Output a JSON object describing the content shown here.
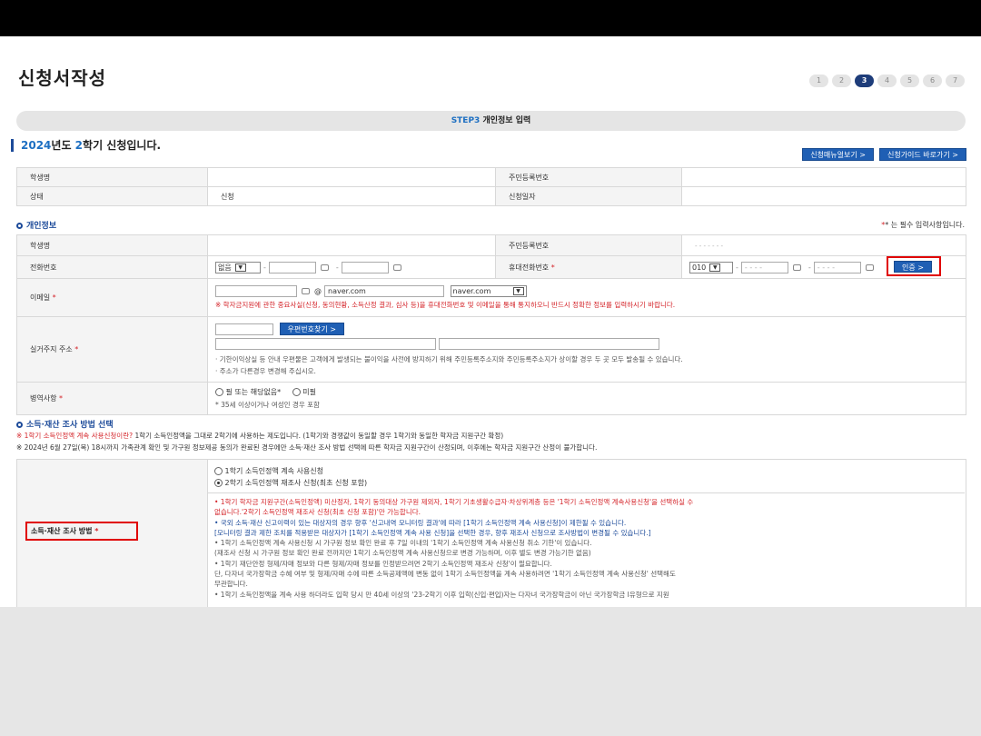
{
  "page": {
    "title": "신청서작성"
  },
  "steps": [
    "1",
    "2",
    "3",
    "4",
    "5",
    "6",
    "7"
  ],
  "active_step": "3",
  "step_banner": {
    "step": "STEP3",
    "label": "개인정보 입력"
  },
  "semester": {
    "year": "2024",
    "year_suffix": "년도 ",
    "term": "2",
    "term_suffix": "학기 신청입니다."
  },
  "buttons": {
    "manual": "신청매뉴얼보기 >",
    "guide": "신청가이드 바로가기 >",
    "verify": "인증 >",
    "zipcode": "우편번호찾기 >"
  },
  "summary": {
    "student_name_label": "학생명",
    "rrn_label": "주민등록번호",
    "status_label": "상태",
    "status_value": "신청",
    "date_label": "신청일자"
  },
  "personal": {
    "section_title": "개인정보",
    "required_note": "* 는 필수 입력사항입니다.",
    "student_name_label": "학생명",
    "rrn_label": "주민등록번호",
    "rrn_value": "- - - - - -    -",
    "phone_label": "전화번호",
    "phone_area": "없음",
    "mobile_label": "휴대전화번호",
    "mobile_prefix": "010",
    "mobile_mid": "- - - -",
    "mobile_last": "- - - -",
    "email_label": "이메일",
    "email_at": "@",
    "email_domain": "naver.com",
    "email_domain_select": "naver.com",
    "email_notice": "※ 학자금지원에 관한 중요사실(신청, 동의현황, 소득산정 결과, 심사 등)을 휴대전화번호 및 이메일을 통해 통지하오니 반드시 정확한 정보를 입력하시기 바랍니다.",
    "address_label": "실거주지 주소",
    "address_note1": "· 기한이익상실 등 안내 우편물은 고객에게 발생되는 불이익을 사전에 방지하기 위해 주민등록주소지와 주민등록주소지가 상이할 경우 두 곳 모두 발송될 수 있습니다.",
    "address_note2": "· 주소가 다른경우 변경해 주십시오.",
    "military_label": "병역사항",
    "military_opt1": "필 또는 해당없음*",
    "military_opt2": "미필",
    "military_note": "* 35세 이상이거나 여성인 경우 포함"
  },
  "income": {
    "section_title": "소득·재산 조사 방법 선택",
    "notice1_red": "※ 1학기 소득인정액 계속 사용신청이란?",
    "notice1_rest": " 1학기 소득인정액을 그대로 2학기에 사용하는 제도입니다. (1학기와 경쟁값이 동일할 경우 1학기와 동일한 학자금 지원구간 확정)",
    "notice2": "※ 2024년 6월 27일(목) 18시까지 가족관계 확인 및 가구원 정보제공 동의가 완료된 경우에만 소득·재산 조사 방법 선택에 따른 학자금 지원구간이 산정되며, 이후에는 학자금 지원구간 산정이 불가합니다.",
    "method_label": "소득·재산 조사 방법",
    "option1": "1학기 소득인정액 계속 사용신청",
    "option2": "2학기 소득인정액 재조사 신청(최초 신청 포함)",
    "bullets": [
      "• 1학기 학자금 지원구간(소득인정액) 미산정자, 1학기 동의대상 가구원 제외자, 1학기 기초생활수급자·차상위계층 등은 '1학기 소득인정액 계속사용신청'을 선택하실 수",
      "  없습니다.'2학기 소득인정액 재조사 신청(최초 신청 포함)'만 가능합니다.",
      "• 국외 소득·재산 신고이력이 있는 대상자의 경우 향후 '신고내역 모니터링 결과'에 따라 [1학기 소득인정액 계속 사용신청]이 제한될 수 있습니다.",
      "  [모니터링 결과 제한 조치를 적용받은 대상자가 [1학기 소득인정액 계속 사용 신청]을 선택한 경우, 향후 재조사 신청으로 조사방법이 변경될 수 있습니다.]",
      "• 1학기 소득인정액 계속 사용신청 시 가구원 정보 확인 완료 후 7일 이내의 '1학기 소득인정액 계속 사용신청 취소 기한'이 있습니다.",
      "  (재조사 신청 시 가구원 정보 확인 완료 전까지만 1학기 소득인정액 계속 사용신청으로 변경 가능하며, 이후 별도 변경 가능기한 없음)",
      "• 1학기 재단안정 형제/자매 정보와 다른 형제/자매 정보를 인정받으려면 2학기 소득인정액 재조사 신청'이 필요합니다.",
      "  단, 다자녀 국가장학금 수혜 여부 및 형제/자매 수에 따른 소득공제액에 변동 없이 1학기 소득인정액을 계속 사용하려면 '1학기 소득인정액 계속 사용신청' 선택해도",
      "  무관합니다.",
      "• 1학기 소득인정액을 계속 사용 하더라도 입학 당시 만 40세 이상의 '23-2학기 이후 입학(신입·편입)자는 다자녀 국가장학금이 아닌 국가장학금 Ⅰ유형으로 지원"
    ],
    "bullet_colors": [
      "red",
      "red",
      "navy",
      "navy",
      "gray",
      "gray",
      "gray",
      "gray",
      "gray",
      "gray"
    ]
  },
  "colors": {
    "brand": "#1d4b9a",
    "button": "#1f5fb4",
    "highlight": "#e00000",
    "step_active": "#1e3d7a"
  }
}
